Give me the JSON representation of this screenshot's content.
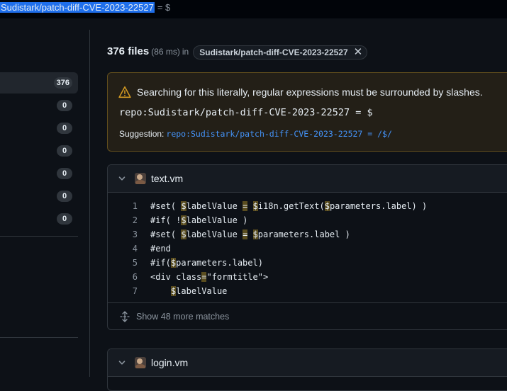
{
  "search": {
    "query_highlighted": "Sudistark/patch-diff-CVE-2023-22527",
    "query_rest": "= $"
  },
  "sidebar": {
    "counts": [
      "376",
      "0",
      "0",
      "0",
      "0",
      "0",
      "0"
    ]
  },
  "results": {
    "count": "376 files",
    "time": "(86 ms)",
    "in_label": "in",
    "repo_chip": "Sudistark/patch-diff-CVE-2023-22527"
  },
  "warning": {
    "message": "Searching for this literally, regular expressions must be surrounded by slashes.",
    "query": "repo:Sudistark/patch-diff-CVE-2023-22527 = $",
    "suggestion_label": "Suggestion:",
    "suggestion_link": "repo:Sudistark/patch-diff-CVE-2023-22527 = /$/"
  },
  "files": [
    {
      "name": "text.vm",
      "lines": [
        {
          "num": "1"
        },
        {
          "num": "2"
        },
        {
          "num": "3"
        },
        {
          "num": "4"
        },
        {
          "num": "5"
        },
        {
          "num": "6"
        },
        {
          "num": "7"
        }
      ],
      "more_matches": "Show 48 more matches"
    },
    {
      "name": "login.vm"
    }
  ],
  "colors": {
    "background": "#0d1117",
    "accent": "#4493f8",
    "warning_border": "#634f1d",
    "match_highlight": "#5a4d1f"
  }
}
